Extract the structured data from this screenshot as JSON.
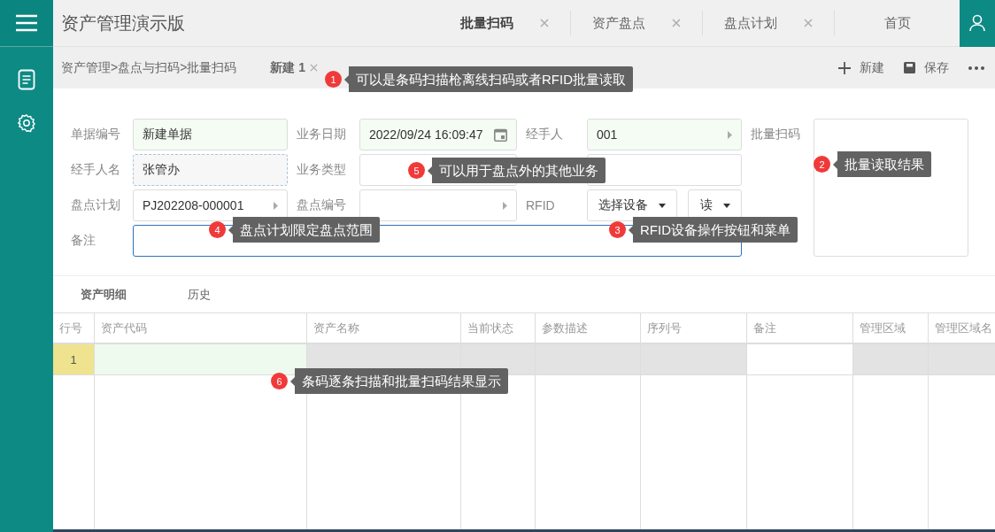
{
  "app": {
    "title": "资产管理演示版"
  },
  "tabs": [
    {
      "label": "批量扫码",
      "selected": true,
      "closable": true
    },
    {
      "label": "资产盘点",
      "selected": false,
      "closable": true
    },
    {
      "label": "盘点计划",
      "selected": false,
      "closable": true
    },
    {
      "label": "首页",
      "selected": false,
      "closable": false
    }
  ],
  "breadcrumb": "资产管理>盘点与扫码>批量扫码",
  "document_tab": {
    "label": "新建 1"
  },
  "toolbar": [
    {
      "kind": "add",
      "label": "新建"
    },
    {
      "kind": "save",
      "label": "保存"
    },
    {
      "kind": "more"
    }
  ],
  "form": {
    "fields": [
      {
        "kind": "text",
        "label": "单据编号",
        "value": "新建单据",
        "required": true,
        "readonly": false
      },
      {
        "kind": "date",
        "label": "业务日期",
        "value": "2022/09/24 16:09:47",
        "required": true,
        "readonly": false
      },
      {
        "kind": "select",
        "label": "经手人",
        "value": "001",
        "required": true,
        "readonly": false
      },
      {
        "kind": "text",
        "label": "经手人名",
        "value": "张管办",
        "required": false,
        "readonly": true
      },
      {
        "kind": "text",
        "label": "业务类型",
        "required": false,
        "readonly": false
      },
      {
        "kind": "text",
        "required": false,
        "readonly": false
      },
      {
        "kind": "select",
        "label": "盘点计划",
        "value": "PJ202208-000001",
        "required": false,
        "readonly": false
      },
      {
        "kind": "select",
        "label": "盘点编号",
        "required": false,
        "readonly": false
      },
      {
        "kind": "buttons",
        "label": "RFID",
        "buttons": [
          "选择设备",
          "读"
        ]
      }
    ],
    "remark": {
      "label": "备注",
      "focused": true
    },
    "batch_scan": {
      "label": "批量扫码"
    }
  },
  "section_tabs": [
    {
      "label": "资产明细",
      "selected": true
    },
    {
      "label": "历史",
      "selected": false
    }
  ],
  "table": {
    "columns": [
      {
        "label": "行号"
      },
      {
        "label": "资产代码",
        "required": true,
        "readonly": false
      },
      {
        "label": "资产名称",
        "required": false,
        "readonly": true
      },
      {
        "label": "当前状态",
        "required": false,
        "readonly": true
      },
      {
        "label": "参数描述",
        "required": false,
        "readonly": true
      },
      {
        "label": "序列号",
        "required": false,
        "readonly": true
      },
      {
        "label": "备注",
        "required": false,
        "readonly": false
      },
      {
        "label": "管理区域",
        "required": false,
        "readonly": true
      },
      {
        "label": "管理区域名",
        "required": false,
        "readonly": true
      }
    ],
    "rows": [
      {
        "number": "1",
        "current": true
      }
    ]
  },
  "callouts": [
    {
      "number": "1",
      "text": "可以是条码扫描枪离线扫码或者RFID批量读取"
    },
    {
      "number": "2",
      "text": "批量读取结果"
    },
    {
      "number": "5",
      "text": "可以用于盘点外的其他业务"
    },
    {
      "number": "4",
      "text": "盘点计划限定盘点范围"
    },
    {
      "number": "3",
      "text": "RFID设备操作按钮和菜单"
    },
    {
      "number": "6",
      "text": "条码逐条扫描和批量扫码结果显示"
    }
  ]
}
